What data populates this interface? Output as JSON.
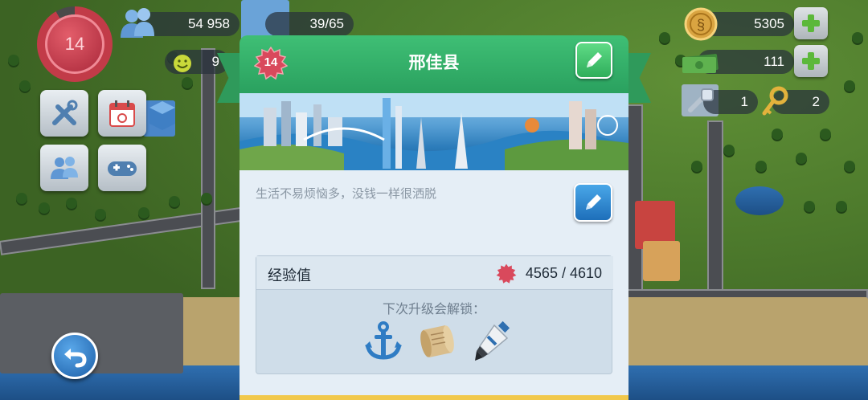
{
  "hud": {
    "player_level": "14",
    "population": "54 958",
    "vip_count": "9",
    "building_capacity": "39/65",
    "simoleons": "5305",
    "simcash": "111",
    "golden_keys_left": "1",
    "golden_keys": "2"
  },
  "dialog": {
    "level_badge": "14",
    "city_name": "邢佳县",
    "motto": "生活不易烦恼多，没钱一样很洒脱",
    "xp_label": "经验值",
    "xp_current": "4565",
    "xp_target": "4610",
    "xp_text": "4565 / 4610",
    "unlock_title": "下次升级会解锁：",
    "unlock_items": [
      {
        "name": "anchor-icon"
      },
      {
        "name": "scroll-icon"
      },
      {
        "name": "glue-tube-icon"
      }
    ]
  },
  "colors": {
    "header_green": "#2aa15f",
    "level_red": "#c23b48",
    "edit_blue": "#1e6fba",
    "panel_bg": "#e5eef6"
  }
}
